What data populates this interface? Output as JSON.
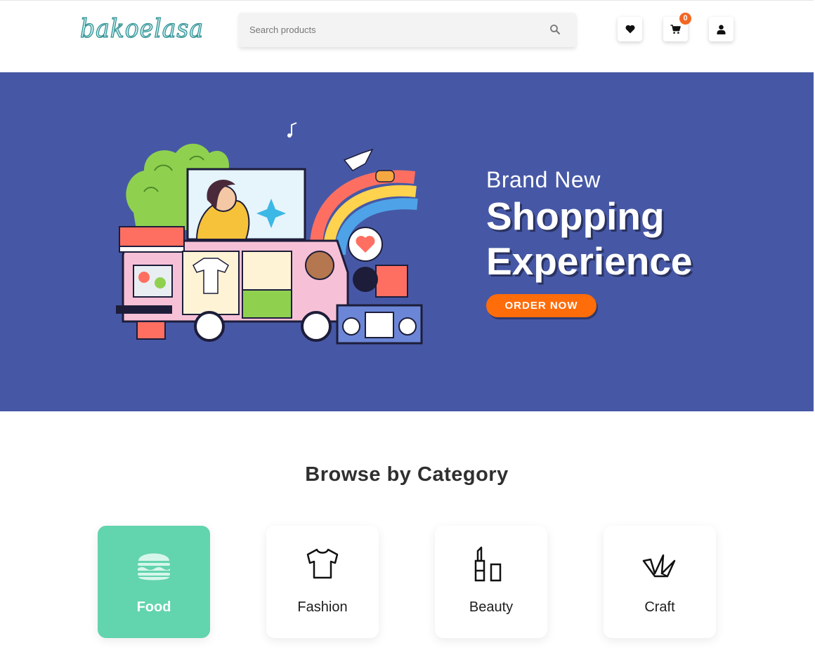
{
  "header": {
    "logo_text": "bakoelasa",
    "search": {
      "placeholder": "Search products",
      "value": ""
    },
    "icons": {
      "wishlist": "heart-icon",
      "cart": "cart-icon",
      "account": "user-icon",
      "search": "search-icon"
    },
    "cart_count": "0"
  },
  "hero": {
    "subtitle": "Brand New",
    "title_line1": "Shopping",
    "title_line2": "Experience",
    "cta_label": "ORDER NOW"
  },
  "browse": {
    "title": "Browse by Category",
    "categories": [
      {
        "label": "Food",
        "icon": "burger-icon",
        "active": true
      },
      {
        "label": "Fashion",
        "icon": "tshirt-icon",
        "active": false
      },
      {
        "label": "Beauty",
        "icon": "lipstick-icon",
        "active": false
      },
      {
        "label": "Craft",
        "icon": "origami-crane-icon",
        "active": false
      }
    ]
  },
  "colors": {
    "hero_bg": "#4658a5",
    "accent_orange": "#ff6c0a",
    "active_category": "#62d4ae",
    "logo_teal": "#3aa5a5"
  }
}
